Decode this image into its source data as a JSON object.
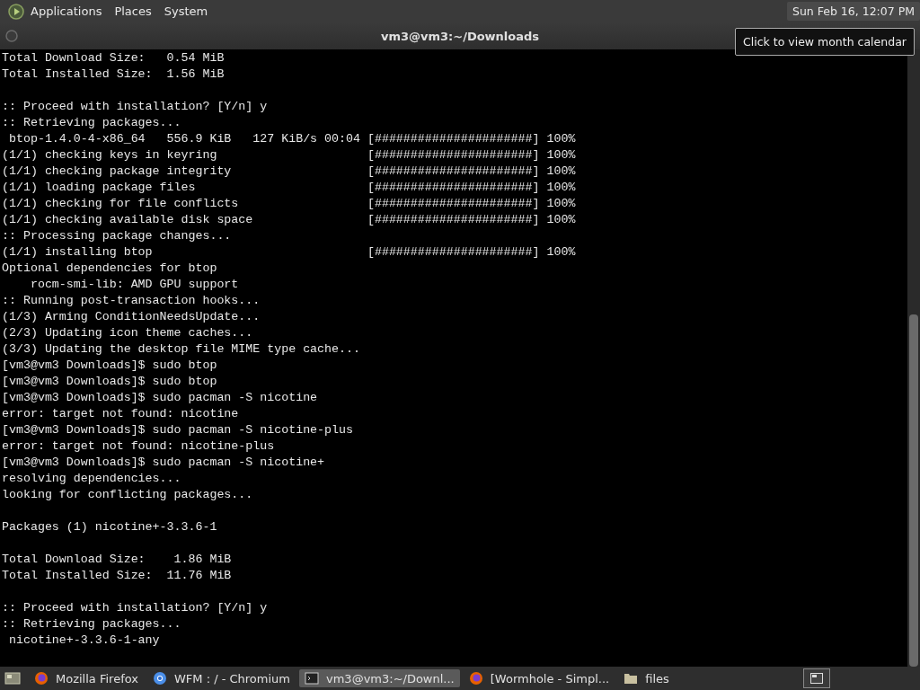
{
  "top_panel": {
    "menus": [
      "Applications",
      "Places",
      "System"
    ],
    "clock": "Sun Feb 16, 12:07 PM",
    "tooltip": "Click to view month calendar"
  },
  "window": {
    "title": "vm3@vm3:~/Downloads"
  },
  "terminal": {
    "lines": [
      {
        "kind": "text",
        "text": "Total Download Size:   0.54 MiB"
      },
      {
        "kind": "text",
        "text": "Total Installed Size:  1.56 MiB"
      },
      {
        "kind": "blank"
      },
      {
        "kind": "text",
        "text": ":: Proceed with installation? [Y/n] y"
      },
      {
        "kind": "text",
        "text": ":: Retrieving packages..."
      },
      {
        "kind": "text",
        "text": " btop-1.4.0-4-x86_64   556.9 KiB   127 KiB/s 00:04 [######################] 100%"
      },
      {
        "kind": "text",
        "text": "(1/1) checking keys in keyring                     [######################] 100%"
      },
      {
        "kind": "text",
        "text": "(1/1) checking package integrity                   [######################] 100%"
      },
      {
        "kind": "text",
        "text": "(1/1) loading package files                        [######################] 100%"
      },
      {
        "kind": "text",
        "text": "(1/1) checking for file conflicts                  [######################] 100%"
      },
      {
        "kind": "text",
        "text": "(1/1) checking available disk space                [######################] 100%"
      },
      {
        "kind": "text",
        "text": ":: Processing package changes..."
      },
      {
        "kind": "text",
        "text": "(1/1) installing btop                              [######################] 100%"
      },
      {
        "kind": "text",
        "text": "Optional dependencies for btop"
      },
      {
        "kind": "text",
        "text": "    rocm-smi-lib: AMD GPU support"
      },
      {
        "kind": "text",
        "text": ":: Running post-transaction hooks..."
      },
      {
        "kind": "text",
        "text": "(1/3) Arming ConditionNeedsUpdate..."
      },
      {
        "kind": "text",
        "text": "(2/3) Updating icon theme caches..."
      },
      {
        "kind": "text",
        "text": "(3/3) Updating the desktop file MIME type cache..."
      },
      {
        "kind": "text",
        "text": "[vm3@vm3 Downloads]$ sudo btop"
      },
      {
        "kind": "text",
        "text": "[vm3@vm3 Downloads]$ sudo btop"
      },
      {
        "kind": "text",
        "text": "[vm3@vm3 Downloads]$ sudo pacman -S nicotine"
      },
      {
        "kind": "text",
        "text": "error: target not found: nicotine"
      },
      {
        "kind": "text",
        "text": "[vm3@vm3 Downloads]$ sudo pacman -S nicotine-plus"
      },
      {
        "kind": "text",
        "text": "error: target not found: nicotine-plus"
      },
      {
        "kind": "text",
        "text": "[vm3@vm3 Downloads]$ sudo pacman -S nicotine+"
      },
      {
        "kind": "text",
        "text": "resolving dependencies..."
      },
      {
        "kind": "text",
        "text": "looking for conflicting packages..."
      },
      {
        "kind": "blank"
      },
      {
        "kind": "text",
        "text": "Packages (1) nicotine+-3.3.6-1"
      },
      {
        "kind": "blank"
      },
      {
        "kind": "text",
        "text": "Total Download Size:    1.86 MiB"
      },
      {
        "kind": "text",
        "text": "Total Installed Size:  11.76 MiB"
      },
      {
        "kind": "blank"
      },
      {
        "kind": "text",
        "text": ":: Proceed with installation? [Y/n] y"
      },
      {
        "kind": "text",
        "text": ":: Retrieving packages..."
      },
      {
        "kind": "text",
        "text": " nicotine+-3.3.6-1-any"
      }
    ]
  },
  "taskbar": {
    "tasks": [
      {
        "kind": "firefox",
        "label": "Mozilla Firefox",
        "selected": false
      },
      {
        "kind": "chromium",
        "label": "WFM : / - Chromium",
        "selected": false
      },
      {
        "kind": "terminal",
        "label": "vm3@vm3:~/Downl...",
        "selected": true
      },
      {
        "kind": "firefox",
        "label": "[Wormhole - Simpl...",
        "selected": false
      },
      {
        "kind": "folder",
        "label": "files",
        "selected": false
      }
    ]
  }
}
